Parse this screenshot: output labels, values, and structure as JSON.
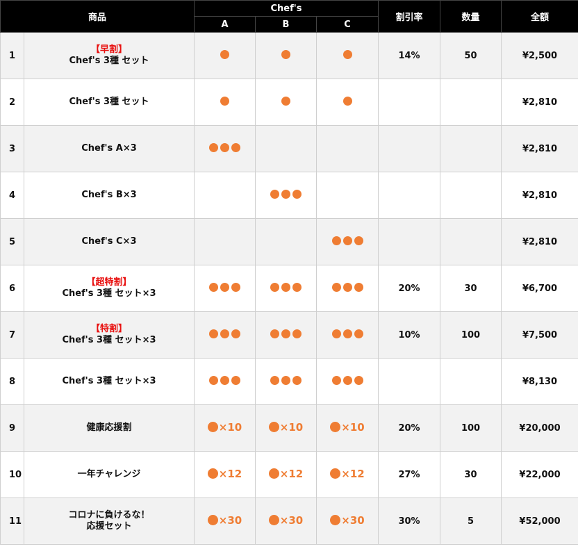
{
  "header": {
    "product": "商品",
    "chefs": "Chef's",
    "chef_a": "A",
    "chef_b": "B",
    "chef_c": "C",
    "discount": "割引率",
    "quantity": "数量",
    "amount": "全額"
  },
  "rows": [
    {
      "no": "1",
      "tag": "【早割】",
      "name": "Chef's 3種 セット",
      "a": 1,
      "b": 1,
      "c": 1,
      "discount": "14%",
      "quantity": "50",
      "amount": "¥2,500"
    },
    {
      "no": "2",
      "tag": "",
      "name": "Chef's 3種 セット",
      "a": 1,
      "b": 1,
      "c": 1,
      "discount": "",
      "quantity": "",
      "amount": "¥2,810"
    },
    {
      "no": "3",
      "tag": "",
      "name": "Chef's A×3",
      "a": 3,
      "b": 0,
      "c": 0,
      "discount": "",
      "quantity": "",
      "amount": "¥2,810"
    },
    {
      "no": "4",
      "tag": "",
      "name": "Chef's B×3",
      "a": 0,
      "b": 3,
      "c": 0,
      "discount": "",
      "quantity": "",
      "amount": "¥2,810"
    },
    {
      "no": "5",
      "tag": "",
      "name": "Chef's C×3",
      "a": 0,
      "b": 0,
      "c": 3,
      "discount": "",
      "quantity": "",
      "amount": "¥2,810"
    },
    {
      "no": "6",
      "tag": "【超特割】",
      "name": "Chef's 3種 セット×3",
      "a": 3,
      "b": 3,
      "c": 3,
      "discount": "20%",
      "quantity": "30",
      "amount": "¥6,700"
    },
    {
      "no": "7",
      "tag": "【特割】",
      "name": "Chef's 3種 セット×3",
      "a": 3,
      "b": 3,
      "c": 3,
      "discount": "10%",
      "quantity": "100",
      "amount": "¥7,500"
    },
    {
      "no": "8",
      "tag": "",
      "name": "Chef's 3種 セット×3",
      "a": 3,
      "b": 3,
      "c": 3,
      "discount": "",
      "quantity": "",
      "amount": "¥8,130"
    },
    {
      "no": "9",
      "tag": "",
      "name": "健康応援割",
      "a": "×10",
      "b": "×10",
      "c": "×10",
      "discount": "20%",
      "quantity": "100",
      "amount": "¥20,000"
    },
    {
      "no": "10",
      "tag": "",
      "name": "一年チャレンジ",
      "a": "×12",
      "b": "×12",
      "c": "×12",
      "discount": "27%",
      "quantity": "30",
      "amount": "¥22,000"
    },
    {
      "no": "11",
      "tag": "",
      "name": "コロナに負けるな！",
      "name2": "応援セット",
      "a": "×30",
      "b": "×30",
      "c": "×30",
      "discount": "30%",
      "quantity": "5",
      "amount": "¥52,000"
    }
  ],
  "colors": {
    "header_bg": "#000000",
    "dot": "#ef7d33",
    "tag": "#e8100f",
    "stripe": "#f2f2f2"
  }
}
